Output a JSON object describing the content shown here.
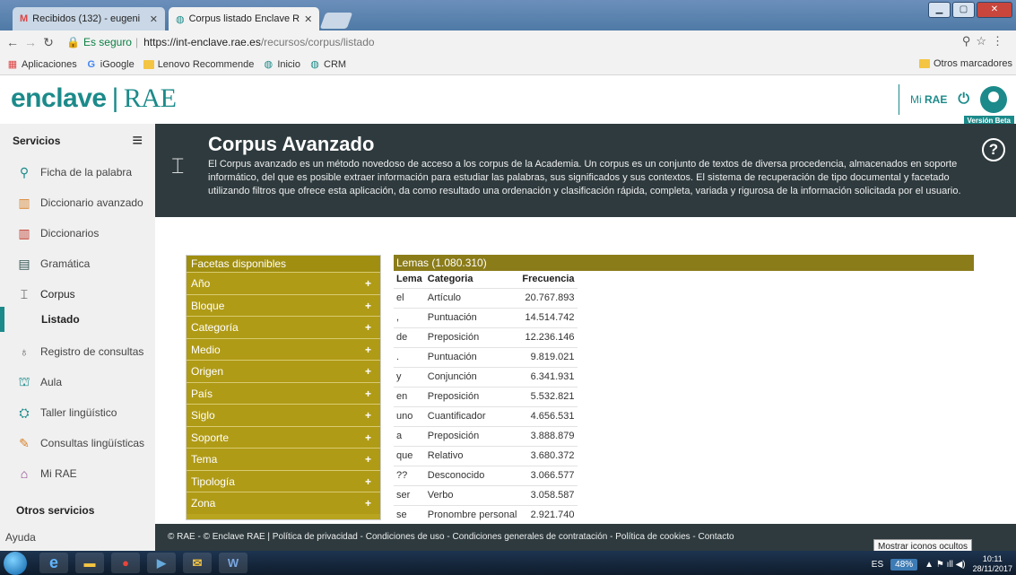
{
  "browser": {
    "tabs": [
      {
        "label": "Recibidos (132) - eugeni",
        "favicon": "gmail-icon"
      },
      {
        "label": "Corpus listado Enclave R",
        "favicon": "rae-icon"
      }
    ],
    "secure_label": "Es seguro",
    "url_host": "https://int-enclave.rae.es",
    "url_path": "/recursos/corpus/listado",
    "bookmarks": [
      "Aplicaciones",
      "iGoogle",
      "Lenovo Recommende",
      "Inicio",
      "CRM"
    ],
    "other_bookmarks": "Otros marcadores"
  },
  "header": {
    "logo_main": "enclave",
    "logo_sep": "|",
    "logo_rae": "RAE",
    "mi_prefix": "Mi",
    "mi_rae": "RAE",
    "beta": "Versión Beta"
  },
  "sidebar": {
    "title": "Servicios",
    "items": [
      {
        "label": "Ficha de la palabra",
        "icon": "search-person-icon"
      },
      {
        "label": "Diccionario avanzado",
        "icon": "book-icon"
      },
      {
        "label": "Diccionarios",
        "icon": "books-icon"
      },
      {
        "label": "Gramática",
        "icon": "grammar-icon"
      },
      {
        "label": "Corpus",
        "icon": "column-icon"
      },
      {
        "label": "Listado",
        "icon": ""
      },
      {
        "label": "Registro de consultas",
        "icon": "bulb-icon"
      },
      {
        "label": "Aula",
        "icon": "classroom-icon"
      },
      {
        "label": "Taller lingüístico",
        "icon": "workshop-icon"
      },
      {
        "label": "Consultas lingüísticas",
        "icon": "question-icon"
      },
      {
        "label": "Mi RAE",
        "icon": "mirae-icon"
      }
    ],
    "other_title": "Otros servicios",
    "help": "Ayuda"
  },
  "banner": {
    "title": "Corpus Avanzado",
    "text": "El Corpus avanzado es un método novedoso de acceso a los corpus de la Academia. Un corpus es un conjunto de textos de diversa procedencia, almacenados en soporte informático, del que es posible extraer información para estudiar las palabras, sus significados y sus contextos. El sistema de recuperación de tipo documental y facetado utilizando filtros que ofrece esta aplicación, da como resultado una ordenación y clasificación rápida, completa, variada y rigurosa de la información solicitada por el usuario.",
    "help": "?"
  },
  "facets": {
    "header": "Facetas disponibles",
    "items": [
      "Año",
      "Bloque",
      "Categoría",
      "Medio",
      "Origen",
      "País",
      "Siglo",
      "Soporte",
      "Tema",
      "Tipología",
      "Zona"
    ],
    "plus": "+"
  },
  "lemas": {
    "title": "Lemas (1.080.310)",
    "columns": [
      "Lema",
      "Categoria",
      "Frecuencia"
    ],
    "rows": [
      [
        "el",
        "Artículo",
        "20.767.893"
      ],
      [
        ",",
        "Puntuación",
        "14.514.742"
      ],
      [
        "de",
        "Preposición",
        "12.236.146"
      ],
      [
        ".",
        "Puntuación",
        "9.819.021"
      ],
      [
        "y",
        "Conjunción",
        "6.341.931"
      ],
      [
        "en",
        "Preposición",
        "5.532.821"
      ],
      [
        "uno",
        "Cuantificador",
        "4.656.531"
      ],
      [
        "a",
        "Preposición",
        "3.888.879"
      ],
      [
        "que",
        "Relativo",
        "3.680.372"
      ],
      [
        "??",
        "Desconocido",
        "3.066.577"
      ],
      [
        "ser",
        "Verbo",
        "3.058.587"
      ],
      [
        "se",
        "Pronombre personal",
        "2.921.740"
      ]
    ]
  },
  "footer": {
    "text": "© RAE - © Enclave RAE | Política de privacidad - Condiciones de uso - Condiciones generales de contratación - Política de cookies - Contacto"
  },
  "taskbar": {
    "tooltip": "Mostrar iconos ocultos",
    "lang": "ES",
    "battery": "48%",
    "time": "10:11",
    "date": "28/11/2017"
  },
  "colors": {
    "accent": "#1c8a8a",
    "banner": "#2e3a3e",
    "facet": "#b09b16",
    "lemas_bar": "#8b7c1a"
  }
}
